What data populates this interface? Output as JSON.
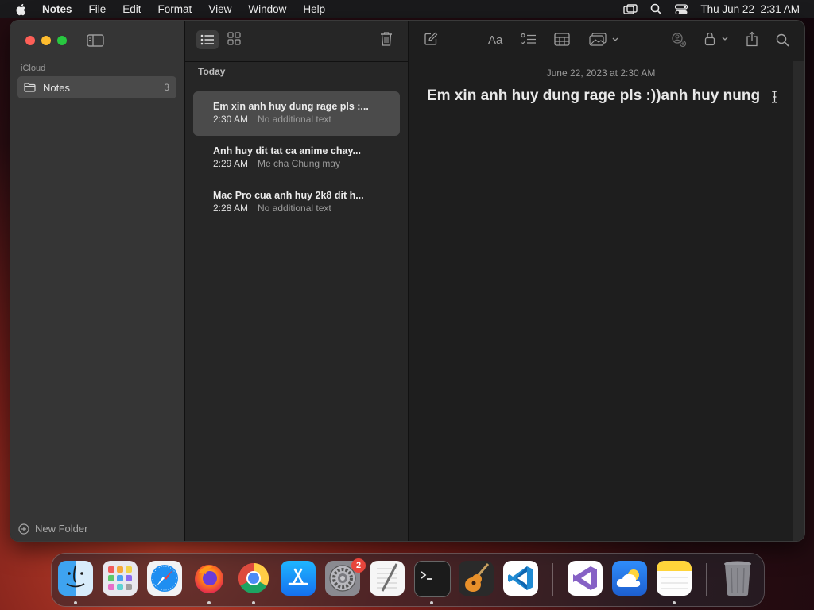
{
  "menubar": {
    "app_name": "Notes",
    "items": [
      "File",
      "Edit",
      "Format",
      "View",
      "Window",
      "Help"
    ],
    "clock": "Thu Jun 22  2:31 AM"
  },
  "sidebar": {
    "section": "iCloud",
    "folder": {
      "label": "Notes",
      "count": "3"
    },
    "new_folder": "New Folder"
  },
  "list": {
    "group": "Today",
    "notes": [
      {
        "title": "Em xin anh huy dung rage pls :...",
        "time": "2:30 AM",
        "preview": "No additional text"
      },
      {
        "title": "Anh huy dit tat ca anime chay...",
        "time": "2:29 AM",
        "preview": "Me cha Chung may"
      },
      {
        "title": "Mac Pro cua anh huy 2k8 dit h...",
        "time": "2:28 AM",
        "preview": "No additional text"
      }
    ]
  },
  "editor": {
    "date": "June 22, 2023 at 2:30 AM",
    "text": "Em xin anh huy dung rage pls :))anh huy nung"
  },
  "dock": {
    "apps": [
      "finder-icon",
      "launchpad-icon",
      "safari-icon",
      "firefox-icon",
      "chrome-icon",
      "app-store-icon",
      "system-settings-icon",
      "textedit-icon",
      "terminal-icon",
      "garageband-icon",
      "vscode-icon",
      "visual-studio-icon",
      "weather-icon",
      "notes-icon",
      "trash-icon"
    ],
    "settings_badge": "2"
  }
}
